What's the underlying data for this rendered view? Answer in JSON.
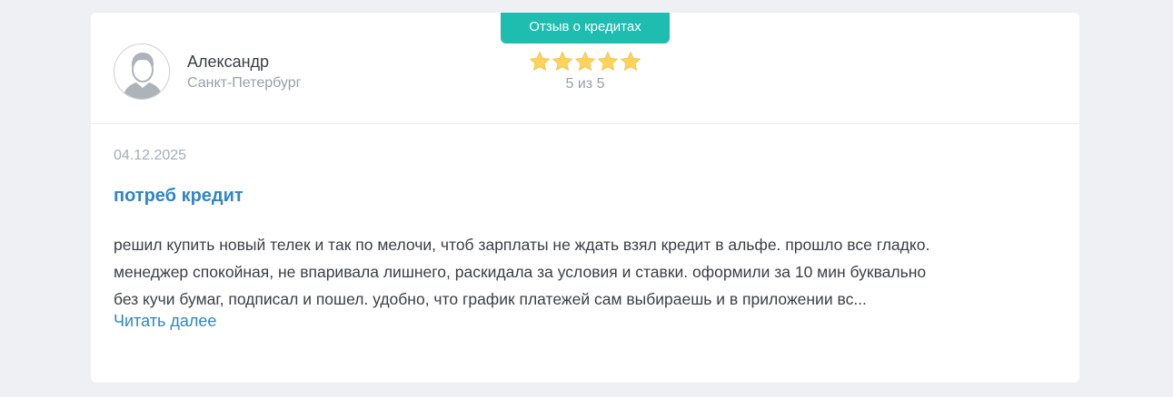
{
  "review": {
    "badge": "Отзыв о кредитах",
    "author": {
      "name": "Александр",
      "city": "Санкт-Петербург"
    },
    "rating": {
      "value": 5,
      "max": 5,
      "label": "5 из 5",
      "star_color": "#fdd35c"
    },
    "date": "04.12.2025",
    "title": "потреб кредит",
    "text_lines": [
      "решил купить новый телек и так по мелочи, чтоб зарплаты не ждать взял кредит в альфе. прошло все гладко.",
      "менеджер спокойная, не впаривала лишнего, раскидала за условия и ставки. оформили за 10 мин буквально",
      "без кучи бумаг, подписал и пошел. удобно, что график платежей сам выбираешь и в приложении вс..."
    ],
    "read_more": "Читать далее"
  },
  "colors": {
    "accent": "#1fbdb0",
    "link": "#2f86c8",
    "background": "#eef0f3"
  }
}
